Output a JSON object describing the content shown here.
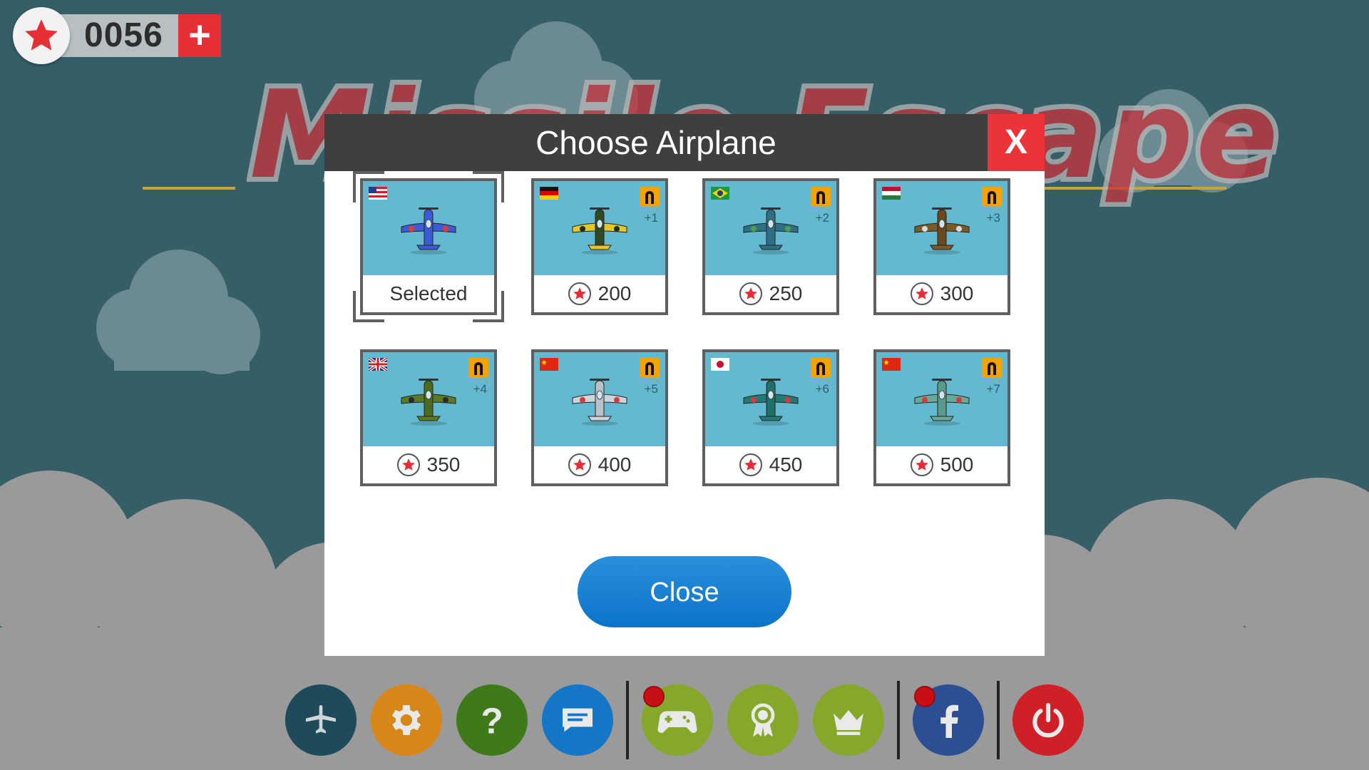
{
  "currency": {
    "count": "0056",
    "add_label": "+"
  },
  "background": {
    "title": "Missile Escape"
  },
  "modal": {
    "title": "Choose Airplane",
    "close_x": "X",
    "close_label": "Close"
  },
  "airplanes": [
    {
      "flag": "usa",
      "selected": true,
      "status": "Selected",
      "price": "",
      "level": "",
      "locked": false,
      "body": "#3d5bd6",
      "wing": "#3d5bd6",
      "accent": "#e23a3a"
    },
    {
      "flag": "germany",
      "selected": false,
      "status": "",
      "price": "200",
      "level": "+1",
      "locked": true,
      "body": "#2f4a22",
      "wing": "#e2c82a",
      "accent": "#1f2f16"
    },
    {
      "flag": "brazil",
      "selected": false,
      "status": "",
      "price": "250",
      "level": "+2",
      "locked": true,
      "body": "#2f6f86",
      "wing": "#2f6f86",
      "accent": "#49a24a"
    },
    {
      "flag": "hungary",
      "selected": false,
      "status": "",
      "price": "300",
      "level": "+3",
      "locked": true,
      "body": "#6a4a1c",
      "wing": "#7a5a26",
      "accent": "#d9d9d9"
    },
    {
      "flag": "uk",
      "selected": false,
      "status": "",
      "price": "350",
      "level": "+4",
      "locked": true,
      "body": "#4d6a1e",
      "wing": "#5a7a26",
      "accent": "#2a2a2a"
    },
    {
      "flag": "china",
      "selected": false,
      "status": "",
      "price": "400",
      "level": "+5",
      "locked": true,
      "body": "#b9c2c9",
      "wing": "#cdd5db",
      "accent": "#d83a3a"
    },
    {
      "flag": "japan",
      "selected": false,
      "status": "",
      "price": "450",
      "level": "+6",
      "locked": true,
      "body": "#1f6f6a",
      "wing": "#237a74",
      "accent": "#d83a3a"
    },
    {
      "flag": "china",
      "selected": false,
      "status": "",
      "price": "500",
      "level": "+7",
      "locked": true,
      "body": "#5a9a8a",
      "wing": "#6aa898",
      "accent": "#d83a3a"
    }
  ],
  "nav": [
    {
      "name": "airplane",
      "icon": "airplane-icon",
      "color": "#1f4a5a",
      "dot": false
    },
    {
      "name": "settings",
      "icon": "gear-icon",
      "color": "#d7861a",
      "dot": false
    },
    {
      "name": "help",
      "icon": "question-icon",
      "color": "#3f7a1a",
      "dot": false
    },
    {
      "name": "chat",
      "icon": "chat-icon",
      "color": "#1476c6",
      "dot": false
    },
    {
      "name": "game-center",
      "icon": "gamepad-icon",
      "color": "#86a82a",
      "dot": true
    },
    {
      "name": "achievements",
      "icon": "award-icon",
      "color": "#86a82a",
      "dot": false
    },
    {
      "name": "leaderboard",
      "icon": "crown-icon",
      "color": "#86a82a",
      "dot": false
    },
    {
      "name": "facebook",
      "icon": "facebook-icon",
      "color": "#2c4f93",
      "dot": true
    },
    {
      "name": "quit",
      "icon": "power-icon",
      "color": "#cf2027",
      "dot": false
    }
  ]
}
